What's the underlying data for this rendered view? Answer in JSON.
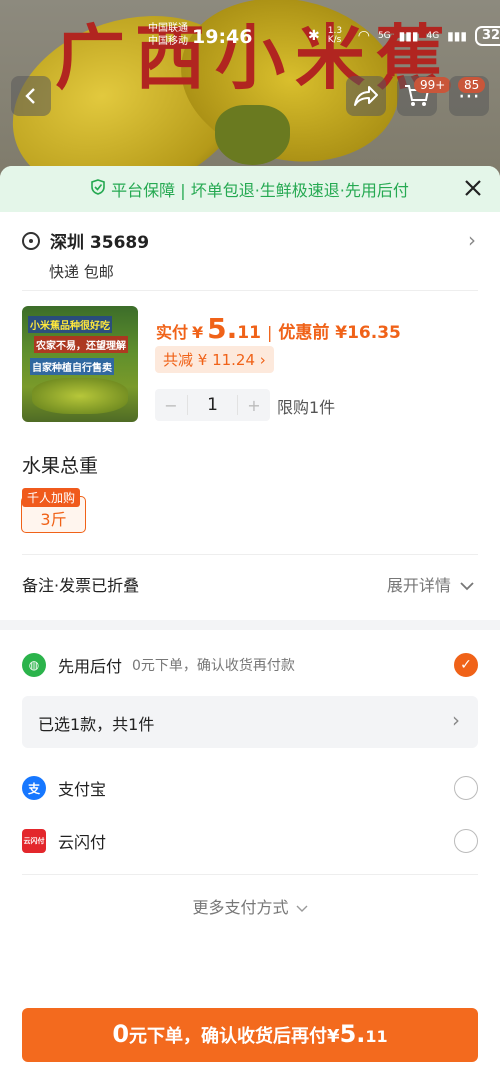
{
  "background": {
    "title": "广西小米蕉"
  },
  "status_bar": {
    "carrier_1": "中国联通",
    "carrier_2": "中国移动",
    "time": "19:46",
    "net_speed": "1.3 K/s",
    "net_1": "5G",
    "net_2": "4G",
    "battery": "32"
  },
  "top_actions": {
    "cart_badge": "99+",
    "msg_badge": "85"
  },
  "guarantee": {
    "text": "平台保障 | 坏单包退·生鲜极速退·先用后付"
  },
  "address": {
    "location": "深圳 35689",
    "shipping": "快递 包邮"
  },
  "product": {
    "image_text_1": "小米蕉品种很好吃",
    "image_text_2": "农家不易，还望理解",
    "image_text_3": "自家种植自行售卖",
    "actual_label": "实付",
    "currency": "¥",
    "price_int": "5.",
    "price_dec": "11",
    "separator": "|",
    "original_price": "优惠前 ¥16.35",
    "discount_chip": "共减 ¥ 11.24 ›",
    "quantity": "1",
    "minus": "−",
    "plus": "+",
    "limit": "限购1件"
  },
  "spec": {
    "title": "水果总重",
    "tag": "千人加购",
    "option": "3斤"
  },
  "remark": {
    "label": "备注·发票已折叠",
    "expand": "展开详情"
  },
  "payments": {
    "bnpl_name": "先用后付",
    "bnpl_desc": "0元下单，确认收货再付款",
    "selected_summary": "已选1款，共1件",
    "alipay_name": "支付宝",
    "alipay_icon": "支",
    "unionpay_name": "云闪付",
    "unionpay_icon": "云闪付",
    "more": "更多支付方式",
    "accent_color": "#f06218"
  },
  "cta": {
    "zero": "0",
    "text": "元下单，确认收货后再付",
    "currency": "¥",
    "int": "5.",
    "dec": "11"
  }
}
